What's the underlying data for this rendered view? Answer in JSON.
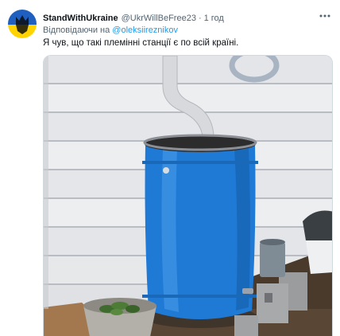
{
  "tweet": {
    "display_name": "StandWithUkraine",
    "handle": "@UkrWillBeFree23",
    "separator": "·",
    "time": "1 год",
    "reply_prefix": "Відповідаючи на ",
    "reply_mention": "@oleksiireznikov",
    "text": "Я чув, що такі племінні станції є по всій країні.",
    "media": {
      "subject": "blue plastic rain barrel under downspout beside white house siding"
    }
  },
  "icons": {
    "more": "more-horizontal-icon"
  },
  "colors": {
    "accent": "#1d9bf0",
    "text_primary": "#0f1419",
    "text_secondary": "#536471",
    "avatar_blue": "#1f5fbf",
    "avatar_yellow": "#ffd400",
    "barrel_blue": "#1f7ad6"
  }
}
